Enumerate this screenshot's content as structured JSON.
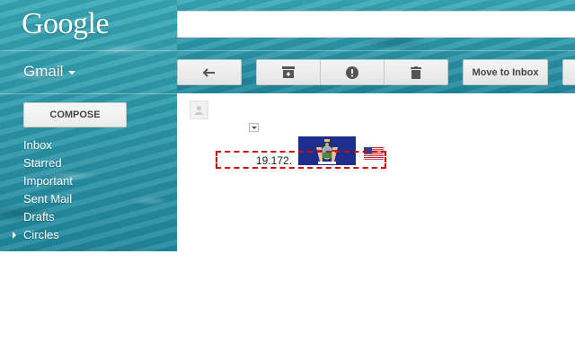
{
  "header": {
    "logo_text": "Google",
    "search_value": ""
  },
  "sidebar": {
    "app_label": "Gmail",
    "compose_label": "COMPOSE",
    "items": [
      {
        "label": "Inbox"
      },
      {
        "label": "Starred"
      },
      {
        "label": "Important"
      },
      {
        "label": "Sent Mail"
      },
      {
        "label": "Drafts"
      },
      {
        "label": "Circles"
      }
    ]
  },
  "toolbar": {
    "back_icon": "back-arrow-icon",
    "archive_icon": "archive-icon",
    "spam_icon": "report-spam-icon",
    "delete_icon": "trash-icon",
    "move_to_inbox_label": "Move to Inbox"
  },
  "message": {
    "avatar_icon": "person-icon",
    "highlighted_text": "19.172."
  },
  "colors": {
    "ocean_theme": "#2f9fae",
    "highlight_border": "#d40000",
    "ny_flag_blue": "#1a2e8a"
  }
}
